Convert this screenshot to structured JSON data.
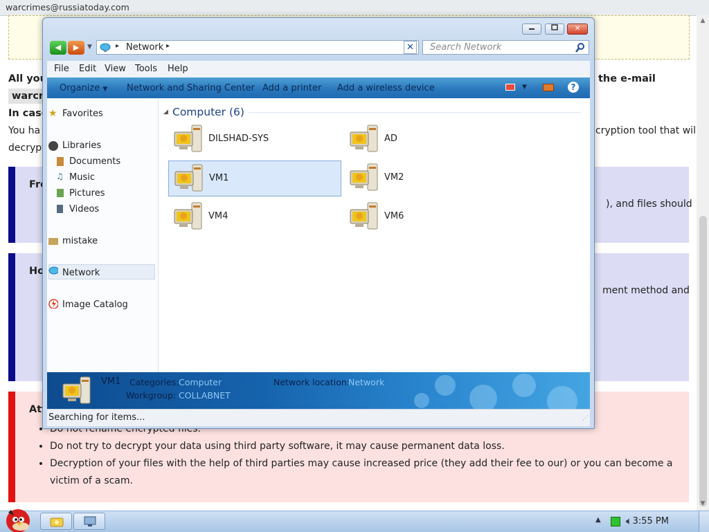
{
  "background": {
    "email_header": "warcrimes@russiatoday.com",
    "line1_left": "All you",
    "line1_right": "the e-mail",
    "email_box": "warcr",
    "incase": "In case",
    "p1_left": "You ha",
    "p1_right": "cryption tool that will",
    "p1_left2": "decrypt",
    "panel1_title": "Free",
    "panel1_text": "), and files should",
    "panel2_title": "How",
    "panel2_text": "ment method and",
    "panel3_title": "Atte",
    "bullets": [
      "Do not rename encrypted files.",
      "Do not try to decrypt your data using third party software, it may cause permanent data loss.",
      "Decryption of your files with the help of third parties may cause increased price (they add their fee to our) or you can become a victim of a scam."
    ]
  },
  "window": {
    "address": {
      "location": "Network"
    },
    "search_placeholder": "Search Network",
    "menu": [
      "File",
      "Edit",
      "View",
      "Tools",
      "Help"
    ],
    "commands": [
      "Organize",
      "Network and Sharing Center",
      "Add a printer",
      "Add a wireless device"
    ],
    "nav": {
      "favorites": "Favorites",
      "libraries": "Libraries",
      "documents": "Documents",
      "music": "Music",
      "pictures": "Pictures",
      "videos": "Videos",
      "mistake": "mistake",
      "network": "Network",
      "image_catalog": "Image Catalog"
    },
    "group_header": "Computer (6)",
    "computers": [
      "DILSHAD-SYS",
      "AD",
      "VM1",
      "VM2",
      "VM4",
      "VM6"
    ],
    "selected": "VM1",
    "details": {
      "name": "VM1",
      "categories_label": "Categories:",
      "categories_value": "Computer",
      "workgroup_label": "Workgroup:",
      "workgroup_value": "COLLABNET",
      "netloc_label": "Network location:",
      "netloc_value": "Network"
    },
    "status": "Searching for items..."
  },
  "taskbar": {
    "clock": "3:55 PM"
  },
  "colors": {
    "accent": "#2b78bd",
    "selection": "#d9e8fb",
    "close": "#d2432a",
    "alert": "#e41111",
    "panel_border": "#0c0c8a"
  }
}
